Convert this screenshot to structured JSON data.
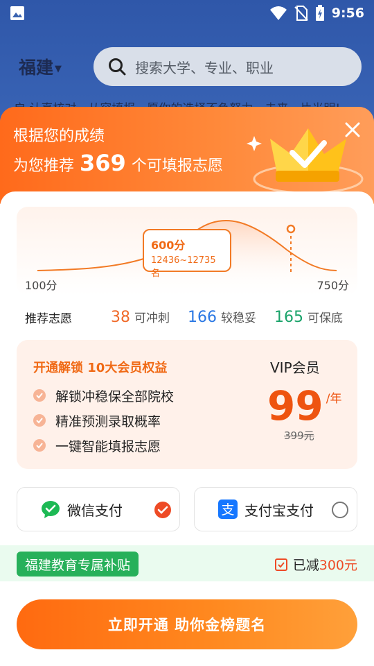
{
  "status_bar": {
    "time": "9:56",
    "icons": [
      "image-icon",
      "wifi-icon",
      "no-sim-icon",
      "battery-charging-icon"
    ]
  },
  "background": {
    "region": "福建",
    "search_placeholder": "搜索大学、专业、职业",
    "ticker": "启 认真核对，从容填报，愿你的选择不负努力，未来一片光明!"
  },
  "header": {
    "line1": "根据您的成绩",
    "line2_prefix": "为您推荐",
    "count": "369",
    "line2_suffix": "个可填报志愿"
  },
  "chart": {
    "score": "600分",
    "rank_range": "12436~12735名",
    "axis_min": "100分",
    "axis_max": "750分"
  },
  "recommend": {
    "label": "推荐志愿",
    "items": [
      {
        "num": "38",
        "text": "可冲刺",
        "color": "#f06a2a"
      },
      {
        "num": "166",
        "text": "较稳妥",
        "color": "#2b78e4"
      },
      {
        "num": "165",
        "text": "可保底",
        "color": "#1aa36a"
      }
    ]
  },
  "vip": {
    "headline": "开通解锁 10大会员权益",
    "benefits": [
      "解锁冲稳保全部院校",
      "精准预测录取概率",
      "一键智能填报志愿"
    ],
    "title": "VIP会员",
    "price": "99",
    "unit": "/年",
    "original_price": "399元"
  },
  "payments": {
    "wechat": "微信支付",
    "alipay": "支付宝支付",
    "selected": "wechat"
  },
  "subsidy": {
    "tag": "福建教育专属补贴",
    "prefix": "已减",
    "amount": "300元"
  },
  "cta": {
    "label": "立即开通  助你金榜题名"
  },
  "colors": {
    "accent": "#ff6a1b",
    "price": "#ee5410",
    "subsidy_green": "#27b05a"
  }
}
